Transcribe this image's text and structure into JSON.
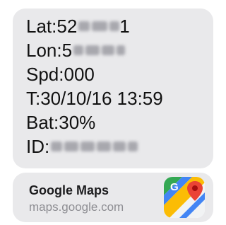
{
  "message": {
    "lat_label": "Lat:",
    "lat_value_visible": "52",
    "lat_value_end": "1",
    "lon_label": "Lon:",
    "lon_value_visible": "5",
    "spd": "Spd:000",
    "time": "T:30/10/16 13:59",
    "bat": "Bat:30%",
    "id_label": "ID:"
  },
  "link_preview": {
    "title": "Google Maps",
    "domain": "maps.google.com",
    "icon": "google-maps-app-icon"
  },
  "colors": {
    "bubble_background": "#e9e9eb",
    "text": "#111111",
    "domain_text": "#8e8e93"
  }
}
